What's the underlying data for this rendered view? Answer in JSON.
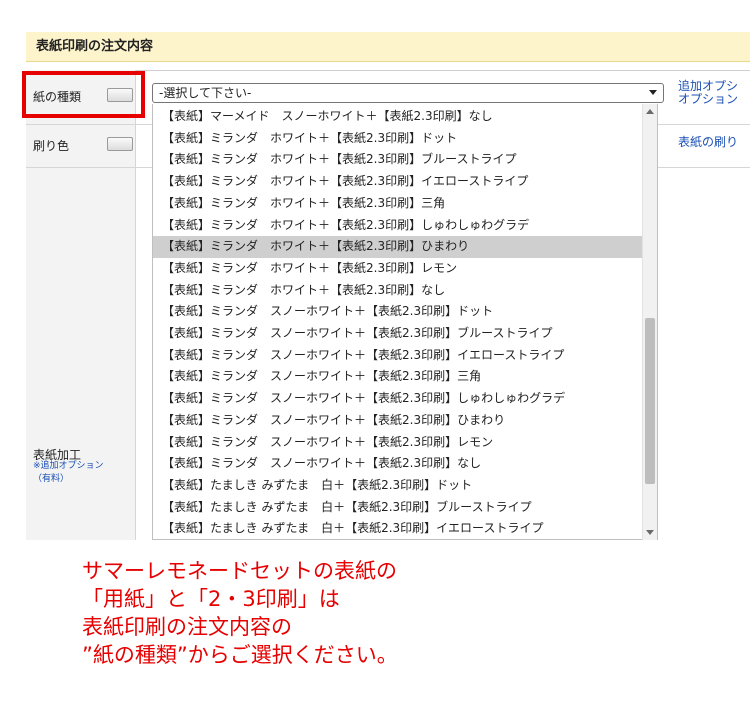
{
  "section": {
    "title": "表紙印刷の注文内容"
  },
  "rows": {
    "paper_type_label": "紙の種類",
    "print_color_label": "刷り色",
    "cover_finish_label": "表紙加工",
    "cover_finish_note_1": "※追加オプション",
    "cover_finish_note_2": "（有料）"
  },
  "select": {
    "value": "-選択して下さい-"
  },
  "side_links": {
    "add_option_1": "追加オプシ",
    "add_option_2": "オプション",
    "cover_print": "表紙の刷り"
  },
  "dropdown": {
    "selected_index": 6,
    "options": [
      "【表紙】マーメイド　スノーホワイト＋【表紙2.3印刷】なし",
      "【表紙】ミランダ　ホワイト＋【表紙2.3印刷】ドット",
      "【表紙】ミランダ　ホワイト＋【表紙2.3印刷】ブルーストライプ",
      "【表紙】ミランダ　ホワイト＋【表紙2.3印刷】イエローストライプ",
      "【表紙】ミランダ　ホワイト＋【表紙2.3印刷】三角",
      "【表紙】ミランダ　ホワイト＋【表紙2.3印刷】しゅわしゅわグラデ",
      "【表紙】ミランダ　ホワイト＋【表紙2.3印刷】ひまわり",
      "【表紙】ミランダ　ホワイト＋【表紙2.3印刷】レモン",
      "【表紙】ミランダ　ホワイト＋【表紙2.3印刷】なし",
      "【表紙】ミランダ　スノーホワイト＋【表紙2.3印刷】ドット",
      "【表紙】ミランダ　スノーホワイト＋【表紙2.3印刷】ブルーストライプ",
      "【表紙】ミランダ　スノーホワイト＋【表紙2.3印刷】イエローストライプ",
      "【表紙】ミランダ　スノーホワイト＋【表紙2.3印刷】三角",
      "【表紙】ミランダ　スノーホワイト＋【表紙2.3印刷】しゅわしゅわグラデ",
      "【表紙】ミランダ　スノーホワイト＋【表紙2.3印刷】ひまわり",
      "【表紙】ミランダ　スノーホワイト＋【表紙2.3印刷】レモン",
      "【表紙】ミランダ　スノーホワイト＋【表紙2.3印刷】なし",
      "【表紙】たましき みずたま　白＋【表紙2.3印刷】ドット",
      "【表紙】たましき みずたま　白＋【表紙2.3印刷】ブルーストライプ",
      "【表紙】たましき みずたま　白＋【表紙2.3印刷】イエローストライプ"
    ]
  },
  "annotation": {
    "line1": "サマーレモネードセットの表紙の",
    "line2": "「用紙」と「2・3印刷」は",
    "line3": "表紙印刷の注文内容の",
    "line4": "”紙の種類”からご選択ください。"
  },
  "colors": {
    "highlight": "#e60000",
    "header_bg": "#fdf4cc",
    "link": "#1a4fb3"
  },
  "icons": {
    "select_caret": "chevron-down-icon",
    "scroll_up": "arrow-up-icon",
    "scroll_down": "arrow-down-icon"
  }
}
